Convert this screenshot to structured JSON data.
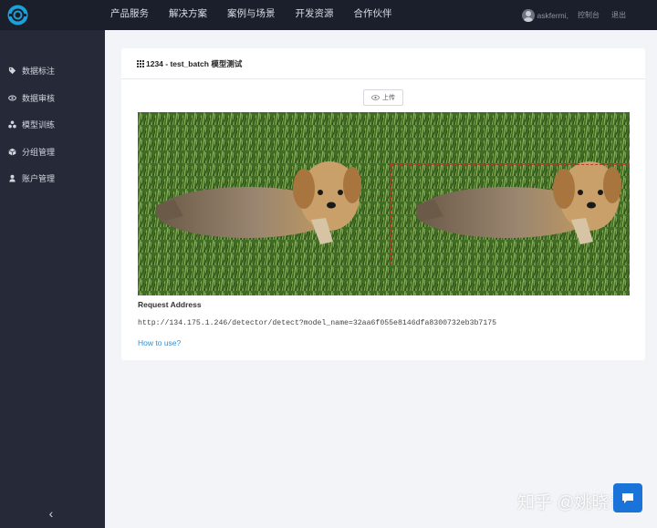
{
  "header": {
    "nav": [
      "产品服务",
      "解决方案",
      "案例与场景",
      "开发资源",
      "合作伙伴"
    ],
    "username": "askfermi,",
    "console_link": "控制台",
    "logout_link": "退出"
  },
  "sidebar": {
    "items": [
      {
        "label": "数据标注",
        "icon": "tag-icon"
      },
      {
        "label": "数据审核",
        "icon": "eye-icon"
      },
      {
        "label": "模型训练",
        "icon": "model-icon"
      },
      {
        "label": "分组管理",
        "icon": "box-icon"
      },
      {
        "label": "账户管理",
        "icon": "user-icon"
      }
    ],
    "collapse": "‹"
  },
  "card": {
    "title": "1234 - test_batch 模型测试",
    "upload_label": "上传",
    "request_label": "Request Address",
    "request_url": "http://134.175.1.246/detector/detect?model_name=32aa6f055e8146dfa8300732eb3b7175",
    "howto_link": "How to use?"
  },
  "watermark": "知乎 @姚晓青",
  "colors": {
    "topbar": "#1b1f2b",
    "sidebar": "#262a38",
    "accent": "#2e8fd6",
    "detect_box": "#c0392b"
  }
}
